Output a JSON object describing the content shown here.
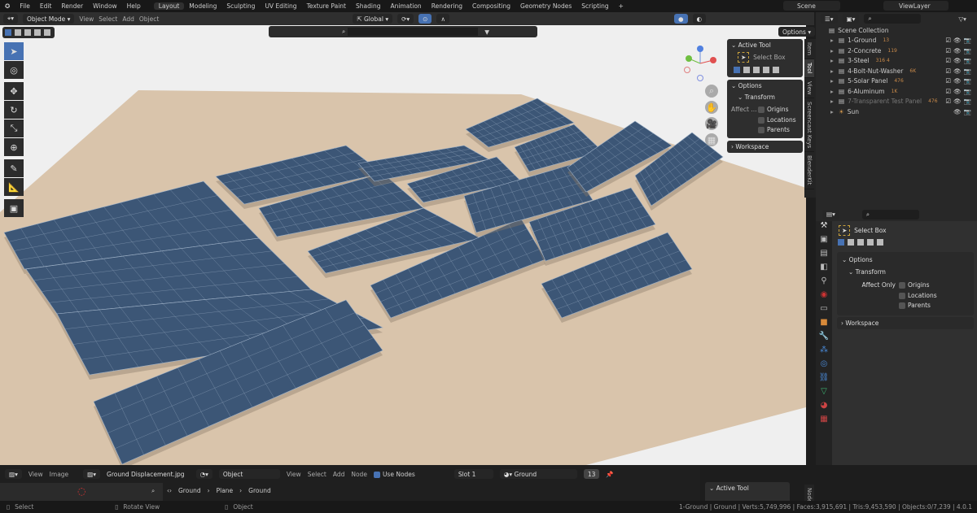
{
  "topbar": {
    "menus": [
      "File",
      "Edit",
      "Render",
      "Window",
      "Help"
    ],
    "workspaces": [
      "Layout",
      "Modeling",
      "Sculpting",
      "UV Editing",
      "Texture Paint",
      "Shading",
      "Animation",
      "Rendering",
      "Compositing",
      "Geometry Nodes",
      "Scripting",
      "+"
    ],
    "scene": "Scene",
    "view_layer": "ViewLayer"
  },
  "viewport_header": {
    "mode": "Object Mode",
    "menus": [
      "View",
      "Select",
      "Add",
      "Object"
    ],
    "transform": "Global",
    "options": "Options"
  },
  "npanel": {
    "active_tool": "Active Tool",
    "tool_name": "Select Box",
    "options": "Options",
    "transform": "Transform",
    "affect": "Affect ...",
    "checks": [
      "Origins",
      "Locations",
      "Parents"
    ],
    "workspace": "Workspace",
    "tabs": [
      "Item",
      "Tool",
      "View",
      "Screencast Keys",
      "BlenderKit"
    ]
  },
  "outliner": {
    "root": "Scene Collection",
    "items": [
      {
        "label": "1-Ground",
        "badge": "13"
      },
      {
        "label": "2-Concrete",
        "badge": "119"
      },
      {
        "label": "3-Steel",
        "badge": "316 4"
      },
      {
        "label": "4-Bolt-Nut-Washer",
        "badge": "6K"
      },
      {
        "label": "5-Solar Panel",
        "badge": "476"
      },
      {
        "label": "6-Aluminum",
        "badge": "1K"
      },
      {
        "label": "7-Transparent Test Panel",
        "badge": "476"
      },
      {
        "label": "Sun",
        "badge": ""
      }
    ]
  },
  "properties": {
    "tool_name": "Select Box",
    "options": "Options",
    "transform": "Transform",
    "affect": "Affect Only",
    "checks": [
      "Origins",
      "Locations",
      "Parents"
    ],
    "workspace": "Workspace"
  },
  "bottom": {
    "menus": [
      "View",
      "Image"
    ],
    "image": "Ground Displacement.jpg",
    "object": "Object",
    "node_menus": [
      "View",
      "Select",
      "Add",
      "Node"
    ],
    "use_nodes": "Use Nodes",
    "slot": "Slot 1",
    "material": "Ground",
    "users": "13",
    "breadcrumb": [
      "Ground",
      "Plane",
      "Ground"
    ],
    "active_tool": "Active Tool",
    "node_tab": "Node"
  },
  "status": {
    "select": "Select",
    "rotate": "Rotate View",
    "object": "Object",
    "info": "1-Ground | Ground | Verts:5,749,996 | Faces:3,915,691 | Tris:9,453,590 | Objects:0/7,239 | 4.0.1"
  },
  "colors": {
    "accent": "#4772b3",
    "panel": "#2e2e2e",
    "sand": "#d9c4ab",
    "solar": "#3c5676"
  }
}
